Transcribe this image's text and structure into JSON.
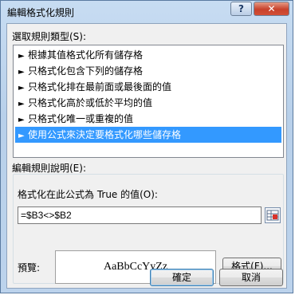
{
  "window": {
    "title": "編輯格式化規則",
    "help_label": "?",
    "close_label": "✕"
  },
  "rule_type": {
    "label": "選取規則類型(S):",
    "items": [
      {
        "label": "根據其值格式化所有儲存格"
      },
      {
        "label": "只格式化包含下列的儲存格"
      },
      {
        "label": "只格式化排在最前面或最後面的值"
      },
      {
        "label": "只格式化高於或低於平均的值"
      },
      {
        "label": "只格式化唯一或重複的值"
      },
      {
        "label": "使用公式來決定要格式化哪些儲存格"
      }
    ],
    "selected_index": 5,
    "arrow_glyph": "►"
  },
  "description": {
    "label": "編輯規則說明(E):",
    "formula_label": "格式化在此公式為 True 的值(O):",
    "formula_value": "=$B3<>$B2",
    "preview_label": "預覽:",
    "preview_text": "AaBbCcYyZz",
    "format_button": "格式(F)..."
  },
  "buttons": {
    "ok": "確定",
    "cancel": "取消"
  },
  "colors": {
    "selection": "#3399ff",
    "title_bar": "#c7dcf2",
    "close_button": "#c8412b"
  }
}
